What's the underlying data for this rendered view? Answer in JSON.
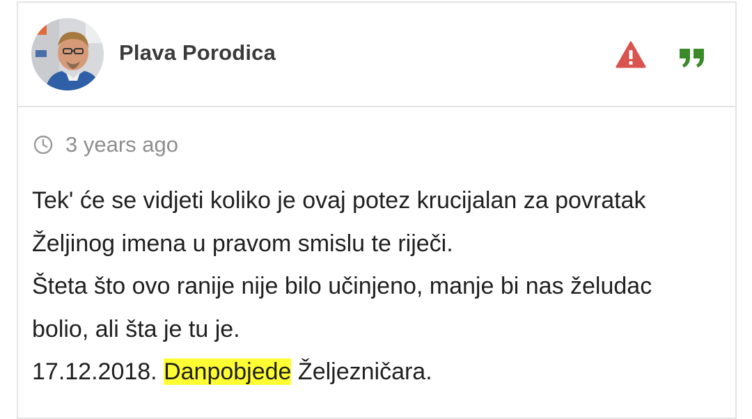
{
  "comment": {
    "author": {
      "name": "Plava Porodica",
      "avatar_icon": "user-avatar-photo"
    },
    "actions": {
      "report_icon": "warning-triangle-icon",
      "report_color": "#d9534f",
      "quote_icon": "quote-icon",
      "quote_color": "#3a8a2a"
    },
    "timestamp": {
      "icon": "clock-icon",
      "text": "3 years ago"
    },
    "body": {
      "line1": "Tek' će se vidjeti koliko je ovaj potez krucijalan za povratak",
      "line2": "Željinog imena u pravom smislu te riječi.",
      "line3": "Šteta što ovo ranije nije bilo učinjeno, manje bi nas želudac",
      "line4": "bolio, ali šta je tu je.",
      "line5_date": "17.12.2018.",
      "line5_highlight": "Danpobjede",
      "line5_rest": "Željezničara.",
      "highlight_color": "#ffff33"
    }
  }
}
